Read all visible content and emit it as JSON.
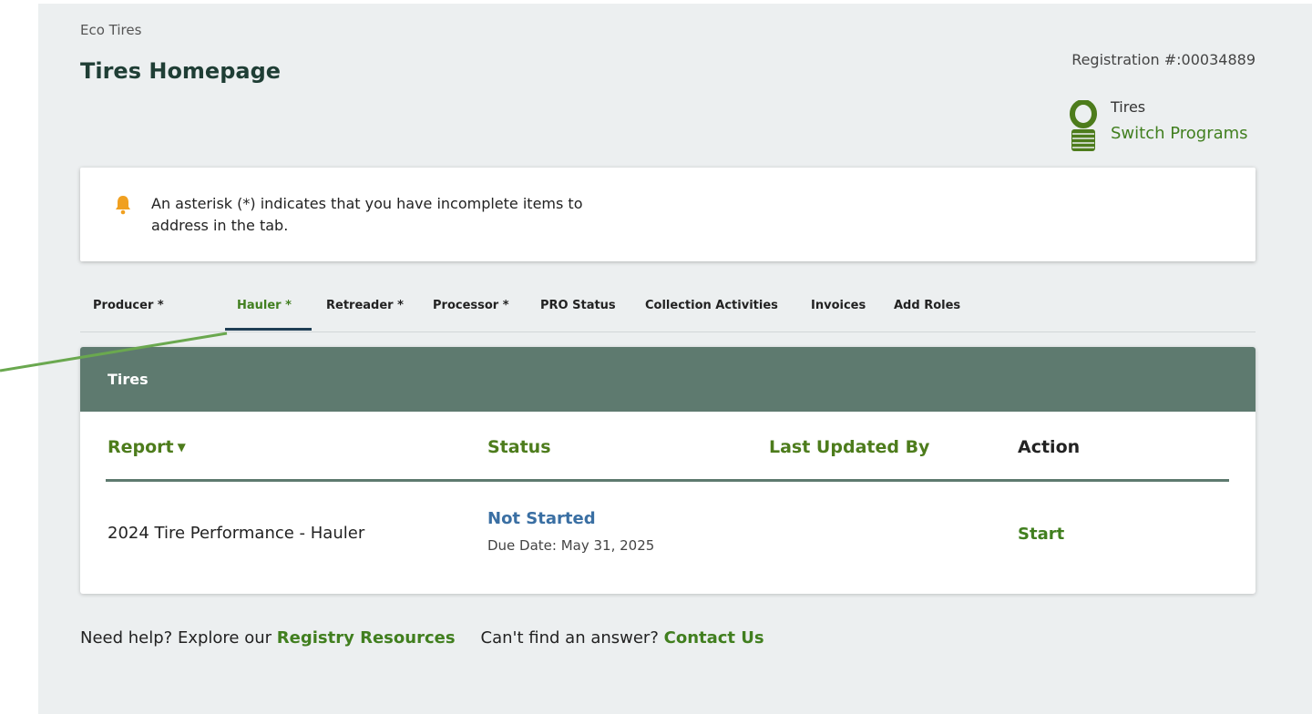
{
  "header": {
    "company": "Eco Tires",
    "title": "Tires Homepage",
    "registration": "Registration #:00034889"
  },
  "program": {
    "name": "Tires",
    "switch_label": "Switch Programs",
    "icon": "tire-stack-icon"
  },
  "notice": {
    "icon": "bell-icon",
    "text": "An asterisk (*) indicates that you have incomplete items to address in the tab."
  },
  "tabs": [
    {
      "label": "Producer *"
    },
    {
      "label": "Hauler *",
      "active": true
    },
    {
      "label": "Retreader *"
    },
    {
      "label": "Processor *"
    },
    {
      "label": "PRO Status"
    },
    {
      "label": "Collection Activities"
    },
    {
      "label": "Invoices"
    },
    {
      "label": "Add Roles"
    }
  ],
  "card": {
    "title": "Tires",
    "columns": {
      "report": "Report",
      "status": "Status",
      "last_updated_by": "Last Updated By",
      "action": "Action"
    },
    "rows": [
      {
        "report": "2024 Tire Performance - Hauler",
        "status": "Not Started",
        "due": "Due Date: May 31, 2025",
        "last_updated_by": "",
        "action": "Start"
      }
    ]
  },
  "help": {
    "prefix": "Need help? Explore our",
    "resources_link": "Registry Resources",
    "contact_prefix": "Can't find an answer?",
    "contact_link": "Contact Us"
  },
  "colors": {
    "brand_green": "#417f1f",
    "header_green": "#5e7a6f",
    "status_blue": "#3a6fa3",
    "bell_orange": "#f0a020",
    "annotation_green": "#6aa84f"
  }
}
